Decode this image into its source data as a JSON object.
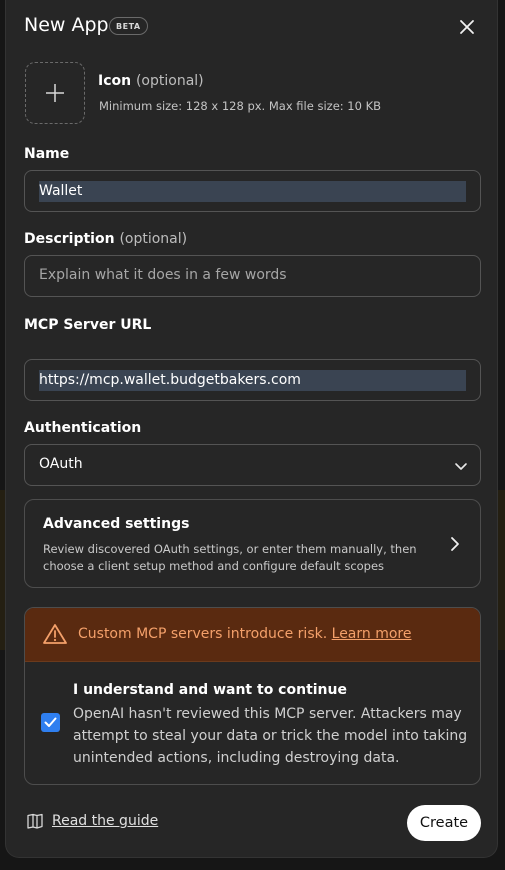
{
  "modal": {
    "title": "New App",
    "badge": "BETA"
  },
  "icon_upload": {
    "label": "Icon",
    "optional": "(optional)",
    "hint": "Minimum size: 128 x 128 px. Max file size: 10 KB"
  },
  "name": {
    "label": "Name",
    "value": "Wallet"
  },
  "description": {
    "label": "Description",
    "optional": "(optional)",
    "placeholder": "Explain what it does in a few words"
  },
  "server_url": {
    "label": "MCP Server URL",
    "value": "https://mcp.wallet.budgetbakers.com"
  },
  "auth": {
    "label": "Authentication",
    "value": "OAuth"
  },
  "advanced": {
    "title": "Advanced settings",
    "description": "Review discovered OAuth settings, or enter them manually, then choose a client setup method and configure default scopes"
  },
  "risk": {
    "warning": "Custom MCP servers introduce risk.",
    "learn_more": "Learn more",
    "ack_title": "I understand and want to continue",
    "ack_desc": "OpenAI hasn't reviewed this MCP server. Attackers may attempt to steal your data or trick the model into taking unintended actions, including destroying data.",
    "checked": true
  },
  "footer": {
    "guide": "Read the guide",
    "create": "Create"
  },
  "colors": {
    "modal_bg": "#262626",
    "accent_checkbox": "#2f7ff0",
    "warning_bg": "#5a2a10",
    "warning_text": "#f4a06a"
  },
  "icons": [
    "close-icon",
    "plus-icon",
    "chevron-down-icon",
    "chevron-right-icon",
    "warning-icon",
    "check-icon",
    "book-icon"
  ]
}
